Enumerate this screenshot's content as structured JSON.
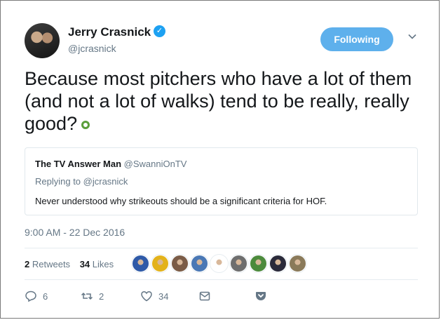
{
  "author": {
    "name": "Jerry Crasnick",
    "handle": "@jcrasnick",
    "follow_label": "Following"
  },
  "tweet": {
    "text": "Because most pitchers who have a lot of them (and not a lot of walks) tend to be really, really good?"
  },
  "quoted_tweet": {
    "name": "The TV Answer Man",
    "handle": "@SwanniOnTV",
    "reply_to": "Replying to @jcrasnick",
    "text": "Never understood why strikeouts should be a significant criteria for HOF."
  },
  "timestamp": "9:00 AM - 22 Dec 2016",
  "stats": {
    "retweets_count": "2",
    "retweets_label": "Retweets",
    "likes_count": "34",
    "likes_label": "Likes"
  },
  "liker_avatars": [
    {
      "color": "#2f5aa8"
    },
    {
      "color": "#e3b21b"
    },
    {
      "color": "#7b5c47"
    },
    {
      "color": "#4a78b5"
    },
    {
      "color": "#ffffff"
    },
    {
      "color": "#6e6e6e"
    },
    {
      "color": "#4c8a3c"
    },
    {
      "color": "#2a2a3a"
    },
    {
      "color": "#8a7a5a"
    }
  ],
  "actions": {
    "reply_count": "6",
    "retweet_count": "2",
    "like_count": "34"
  },
  "colors": {
    "accent": "#1da1f2",
    "follow_button": "#5eb0ec",
    "muted_text": "#657786"
  }
}
